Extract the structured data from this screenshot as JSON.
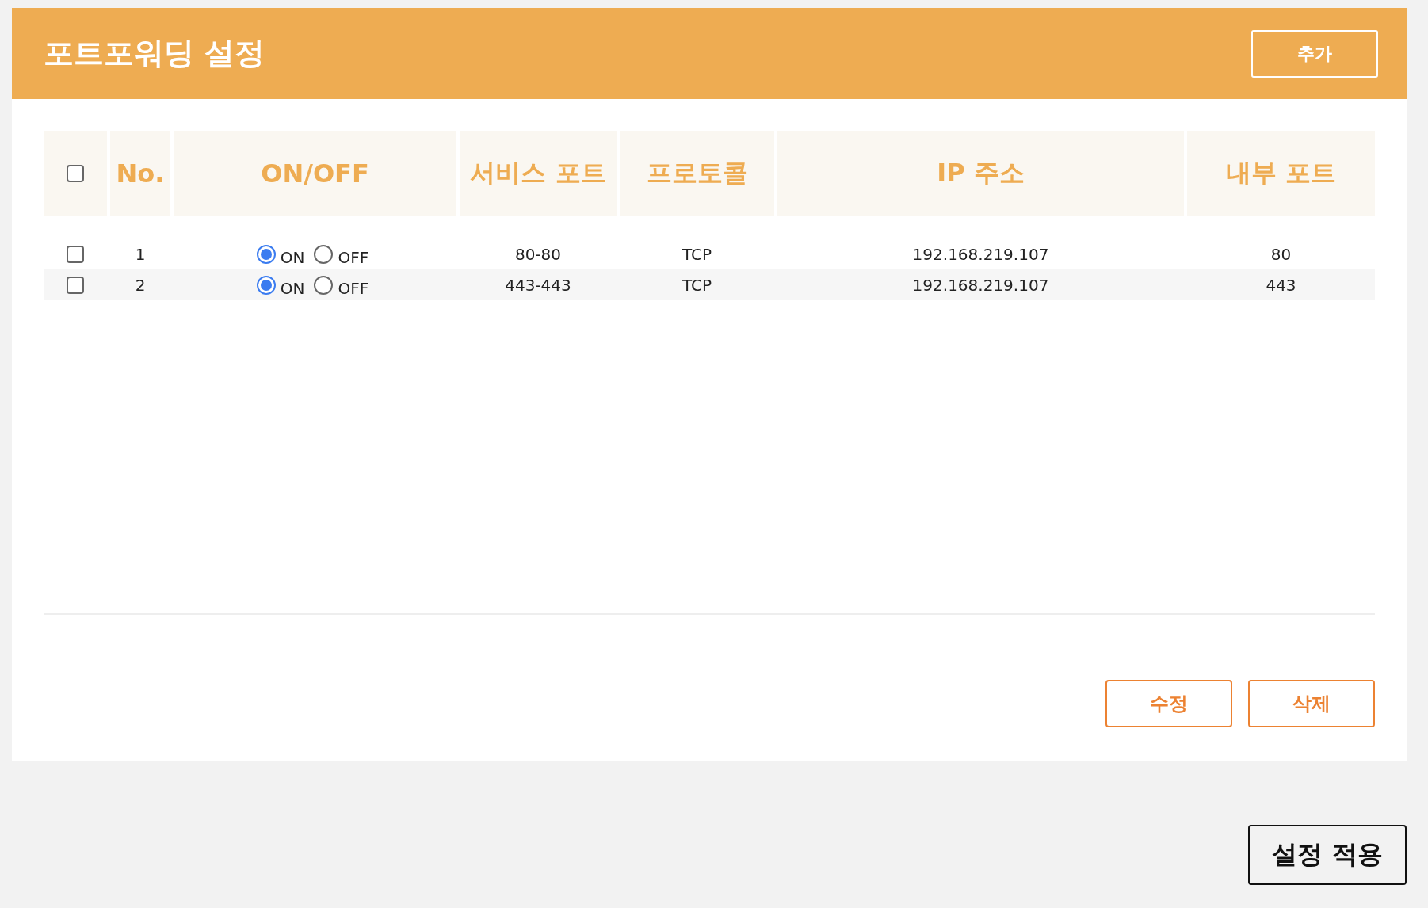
{
  "header": {
    "title": "포트포워딩 설정",
    "add_button": "추가"
  },
  "table": {
    "select_all": {
      "checked": false
    },
    "columns": [
      "No.",
      "ON/OFF",
      "서비스 포트",
      "프로토콜",
      "IP 주소",
      "내부 포트"
    ],
    "rows": [
      {
        "checked": false,
        "no": "1",
        "on_label": "ON",
        "off_label": "OFF",
        "on": true,
        "service_port": "80-80",
        "protocol": "TCP",
        "ip": "192.168.219.107",
        "internal_port": "80"
      },
      {
        "checked": false,
        "no": "2",
        "on_label": "ON",
        "off_label": "OFF",
        "on": true,
        "service_port": "443-443",
        "protocol": "TCP",
        "ip": "192.168.219.107",
        "internal_port": "443"
      }
    ]
  },
  "actions": [
    "수정",
    "삭제"
  ],
  "apply_button": "설정 적용"
}
